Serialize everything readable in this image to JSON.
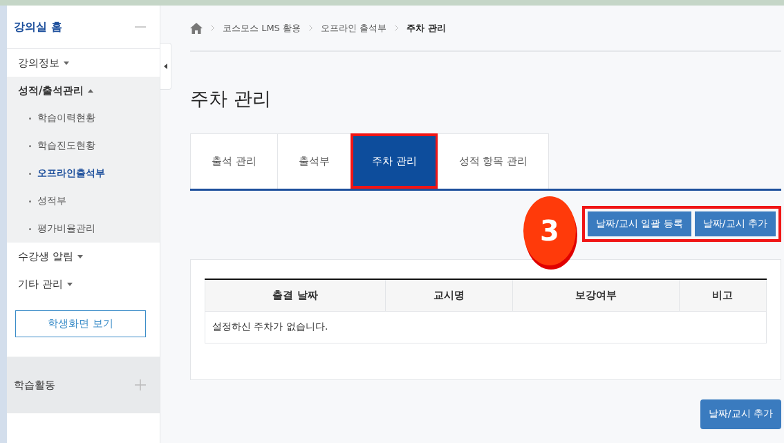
{
  "sidebar": {
    "home": {
      "label": "강의실 홈",
      "expanded": true
    },
    "menu": [
      {
        "label": "강의정보",
        "expanded": false
      },
      {
        "label": "성적/출석관리",
        "expanded": true,
        "children": [
          {
            "label": "학습이력현황",
            "selected": false
          },
          {
            "label": "학습진도현황",
            "selected": false
          },
          {
            "label": "오프라인출석부",
            "selected": true
          },
          {
            "label": "성적부",
            "selected": false
          },
          {
            "label": "평가비율관리",
            "selected": false
          }
        ]
      },
      {
        "label": "수강생 알림",
        "expanded": false
      },
      {
        "label": "기타 관리",
        "expanded": false
      }
    ],
    "student_view_button": "학생화면 보기",
    "section": {
      "label": "학습활동",
      "expanded": false
    }
  },
  "breadcrumb": [
    "코스모스 LMS 활용",
    "오프라인 출석부",
    "주차 관리"
  ],
  "page_title": "주차 관리",
  "tabs": [
    {
      "label": "출석 관리",
      "selected": false,
      "highlighted": false
    },
    {
      "label": "출석부",
      "selected": false,
      "highlighted": false
    },
    {
      "label": "주차 관리",
      "selected": true,
      "highlighted": true
    },
    {
      "label": "성적 항목 관리",
      "selected": false,
      "highlighted": false
    }
  ],
  "annotation": {
    "label": "3"
  },
  "actions": {
    "highlighted": true,
    "buttons": [
      "날짜/교시 일괄 등록",
      "날짜/교시 추가"
    ]
  },
  "table": {
    "columns": [
      "출결 날짜",
      "교시명",
      "보강여부",
      "비고"
    ],
    "empty_message": "설정하신 주차가 없습니다."
  },
  "bottom_button": "날짜/교시 추가"
}
